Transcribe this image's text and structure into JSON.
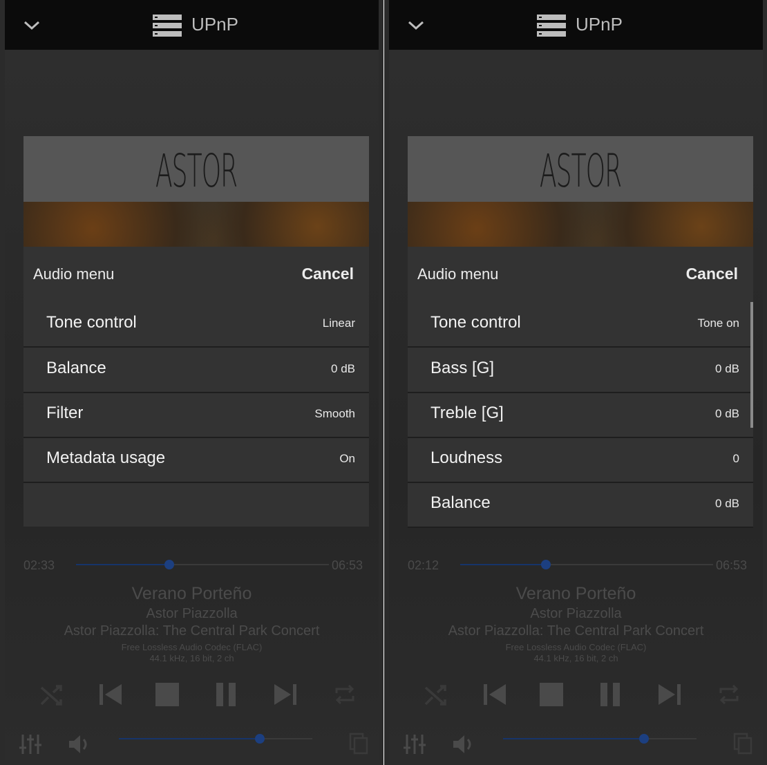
{
  "colors": {
    "accent": "#1c3f80",
    "background": "#2d2d2d",
    "dialog": "#333333"
  },
  "panels": [
    {
      "header": {
        "title": "UPnP"
      },
      "dialog": {
        "title": "Audio menu",
        "cancel_label": "Cancel",
        "items": [
          {
            "label": "Tone control",
            "value": "Linear"
          },
          {
            "label": "Balance",
            "value": "0 dB"
          },
          {
            "label": "Filter",
            "value": "Smooth"
          },
          {
            "label": "Metadata usage",
            "value": "On"
          }
        ]
      },
      "player": {
        "elapsed": "02:33",
        "duration": "06:53",
        "progress": 0.37,
        "volume": 0.73,
        "track_title": "Verano Porteño",
        "artist": "Astor Piazzolla",
        "album": "Astor Piazzolla: The Central Park Concert",
        "codec": "Free Lossless Audio Codec (FLAC)",
        "format": "44.1 kHz, 16 bit, 2 ch"
      }
    },
    {
      "header": {
        "title": "UPnP"
      },
      "dialog": {
        "title": "Audio menu",
        "cancel_label": "Cancel",
        "items": [
          {
            "label": "Tone control",
            "value": "Tone on"
          },
          {
            "label": "Bass [G]",
            "value": "0 dB"
          },
          {
            "label": "Treble [G]",
            "value": "0 dB"
          },
          {
            "label": "Loudness",
            "value": "0"
          },
          {
            "label": "Balance",
            "value": "0 dB"
          }
        ]
      },
      "player": {
        "elapsed": "02:12",
        "duration": "06:53",
        "progress": 0.34,
        "volume": 0.73,
        "track_title": "Verano Porteño",
        "artist": "Astor Piazzolla",
        "album": "Astor Piazzolla: The Central Park Concert",
        "codec": "Free Lossless Audio Codec (FLAC)",
        "format": "44.1 kHz, 16 bit, 2 ch"
      }
    }
  ],
  "album_art": {
    "text": "ASTOR PIAZZOLLA"
  },
  "icons": [
    "chevron-down-icon",
    "server-icon",
    "shuffle-icon",
    "skip-previous-icon",
    "stop-icon",
    "pause-icon",
    "skip-next-icon",
    "repeat-icon",
    "equalizer-icon",
    "volume-icon",
    "copy-icon"
  ]
}
